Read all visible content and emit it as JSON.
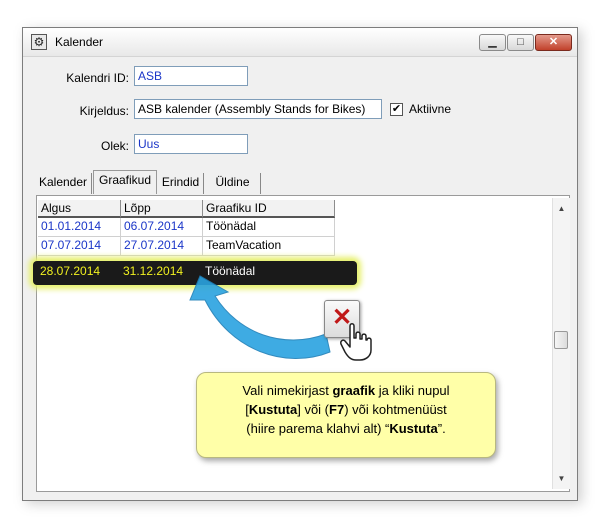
{
  "window": {
    "title": "Kalender",
    "app_icon": "gear-icon",
    "min_icon": "minimize-icon",
    "max_icon": "maximize-icon",
    "close_icon": "close-icon"
  },
  "form": {
    "kalendri_id_label": "Kalendri ID:",
    "kalendri_id_value": "ASB",
    "kirjeldus_label": "Kirjeldus:",
    "kirjeldus_value": "ASB kalender (Assembly Stands for Bikes)",
    "aktiivne_label": "Aktiivne",
    "aktiivne_checked": true,
    "olek_label": "Olek:",
    "olek_value": "Uus"
  },
  "tabs": [
    "Kalender",
    "Graafikud",
    "Erindid",
    "Üldine"
  ],
  "active_tab": "Graafikud",
  "table": {
    "columns": [
      "Algus",
      "Lõpp",
      "Graafiku ID"
    ],
    "rows": [
      {
        "algus": "01.01.2014",
        "lopp": "06.07.2014",
        "graafiku_id": "Töönädal"
      },
      {
        "algus": "07.07.2014",
        "lopp": "27.07.2014",
        "graafiku_id": "TeamVacation"
      },
      {
        "algus": "28.07.2014",
        "lopp": "31.12.2014",
        "graafiku_id": "Töönädal"
      }
    ],
    "selected_row": 3
  },
  "callout": {
    "line1_a": "Vali nimekirjast ",
    "line1_b": "graafik",
    "line1_c": " ja kliki nupul",
    "line2_a": "[",
    "line2_b": "Kustuta",
    "line2_c": "] või (",
    "line2_d": "F7",
    "line2_e": ") või kohtmenüüst",
    "line3_a": "(hiire parema klahvi alt) “",
    "line3_b": "Kustuta",
    "line3_c": "”."
  },
  "colors": {
    "value_text": "#1b36c8",
    "highlight_glow": "#e6f06a",
    "callout_bg": "#ffffa8",
    "arrow": "#2aa3e0",
    "delete_x": "#c01818"
  }
}
